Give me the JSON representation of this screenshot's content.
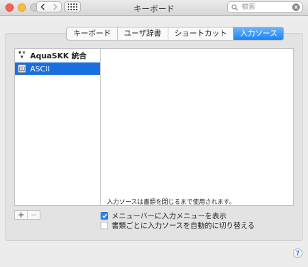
{
  "window": {
    "title": "キーボード"
  },
  "search": {
    "placeholder": "検索"
  },
  "tabs": [
    {
      "label": "キーボード",
      "active": false
    },
    {
      "label": "ユーザ辞書",
      "active": false
    },
    {
      "label": "ショートカット",
      "active": false
    },
    {
      "label": "入力ソース",
      "active": true
    }
  ],
  "input_sources": {
    "group_label": "AquaSKK 統合",
    "items": [
      {
        "label": "ASCII",
        "selected": true
      }
    ]
  },
  "controls": {
    "add_label": "+",
    "remove_label": "−"
  },
  "options": {
    "show_menu_label": "メニューバーに入力メニューを表示",
    "show_menu_checked": true,
    "auto_switch_label": "書類ごとに入力ソースを自動的に切り替える",
    "auto_switch_checked": false,
    "note": "入力ソースは書類を閉じるまで使用されます。"
  },
  "help_label": "?",
  "colors": {
    "accent": "#1a6fe0",
    "tab_active": "#1b84f7"
  }
}
